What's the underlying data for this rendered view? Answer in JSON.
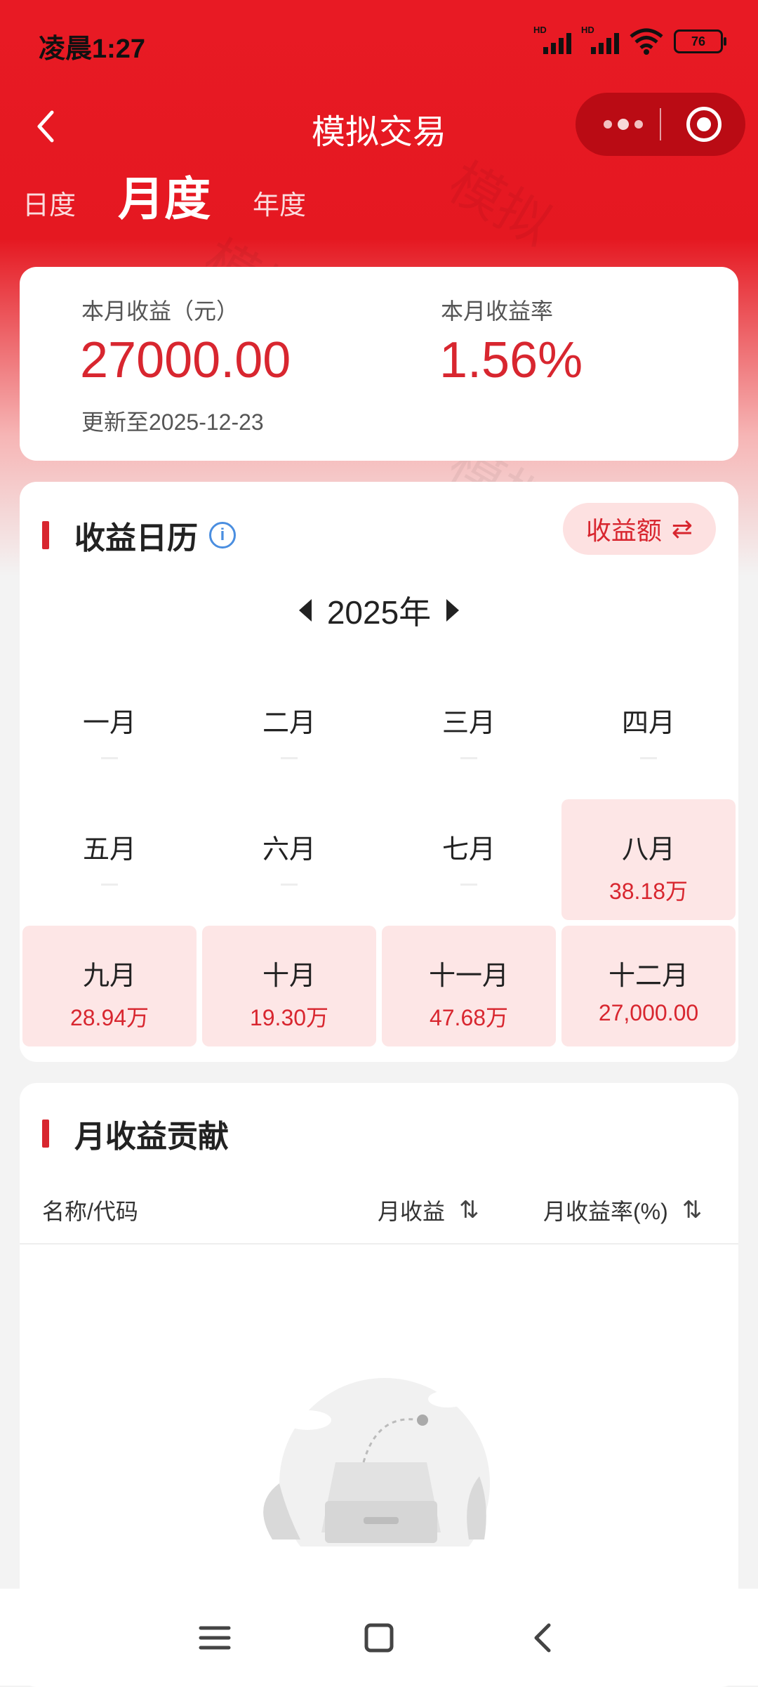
{
  "status_bar": {
    "time": "凌晨1:27",
    "signal1_label": "HD",
    "signal2_label": "HD",
    "battery": "76"
  },
  "nav": {
    "title": "模拟交易"
  },
  "period_tabs": [
    {
      "label": "日度",
      "active": false
    },
    {
      "label": "月度",
      "active": true
    },
    {
      "label": "年度",
      "active": false
    }
  ],
  "summary": {
    "income_label": "本月收益（元）",
    "income_value": "27000.00",
    "rate_label": "本月收益率",
    "rate_value": "1.56%",
    "updated": "更新至2025-12-23"
  },
  "calendar": {
    "title": "收益日历",
    "info_icon_glyph": "i",
    "toggle_label": "收益额",
    "toggle_icon_glyph": "⇄",
    "year": "2025年",
    "months": [
      {
        "name": "一月",
        "value": ""
      },
      {
        "name": "二月",
        "value": ""
      },
      {
        "name": "三月",
        "value": ""
      },
      {
        "name": "四月",
        "value": ""
      },
      {
        "name": "五月",
        "value": ""
      },
      {
        "name": "六月",
        "value": ""
      },
      {
        "name": "七月",
        "value": ""
      },
      {
        "name": "八月",
        "value": "38.18万"
      },
      {
        "name": "九月",
        "value": "28.94万"
      },
      {
        "name": "十月",
        "value": "19.30万"
      },
      {
        "name": "十一月",
        "value": "47.68万"
      },
      {
        "name": "十二月",
        "value": "27,000.00"
      }
    ]
  },
  "contribution": {
    "title": "月收益贡献",
    "columns": {
      "name": "名称/代码",
      "monthly_income": "月收益",
      "monthly_rate": "月收益率(%)"
    },
    "sort_glyph": "⇅"
  },
  "watermark_text": "模拟",
  "colors": {
    "brand_red": "#e51821",
    "accent_red": "#d8262f",
    "highlight_bg": "#fde6e6"
  }
}
